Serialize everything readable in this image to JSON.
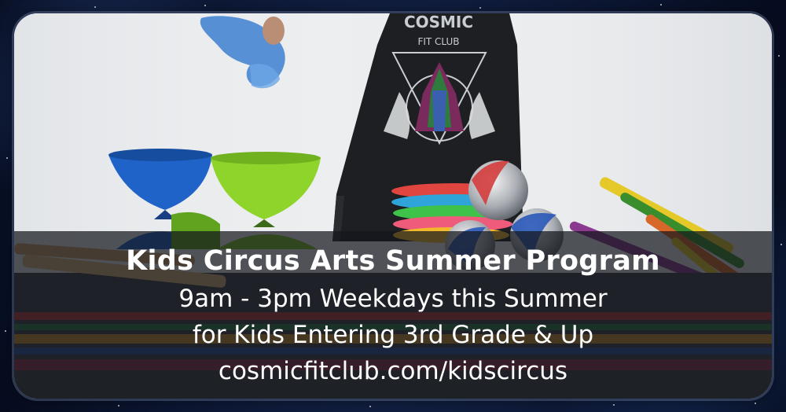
{
  "banner": {
    "title": "Kids Circus Arts Summer Program",
    "line1": "9am - 3pm Weekdays this Summer",
    "line2": "for Kids Entering 3rd Grade & Up",
    "line3": "cosmicfitclub.com/kidscircus"
  },
  "shirt_logo": {
    "brand": "COSMIC",
    "subtitle": "FIT CLUB"
  },
  "colors": {
    "space_background": "#0b1530",
    "caption_band": "#14161c",
    "caption_text": "#ffffff",
    "diabolo_blue": "#1f63c9",
    "diabolo_green": "#8ed42a"
  }
}
